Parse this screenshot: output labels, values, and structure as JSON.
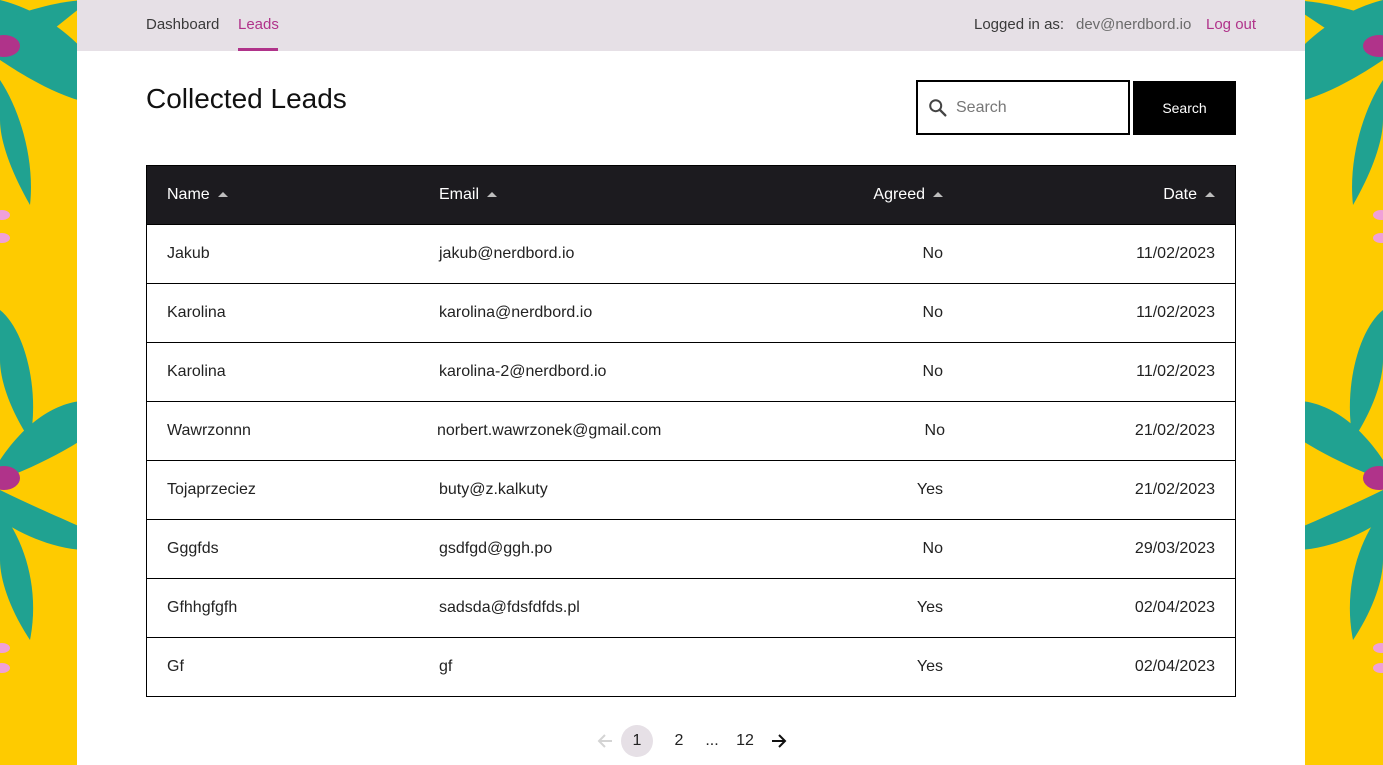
{
  "nav": {
    "items": [
      {
        "label": "Dashboard",
        "active": false
      },
      {
        "label": "Leads",
        "active": true
      }
    ],
    "logged_in_label": "Logged in as:",
    "user_email": "dev@nerdbord.io",
    "logout_label": "Log out"
  },
  "page": {
    "title": "Collected Leads"
  },
  "search": {
    "placeholder": "Search",
    "value": "",
    "button_label": "Search"
  },
  "table": {
    "columns": [
      {
        "label": "Name"
      },
      {
        "label": "Email"
      },
      {
        "label": "Agreed"
      },
      {
        "label": "Date"
      }
    ],
    "rows": [
      {
        "name": "Jakub",
        "email": "jakub@nerdbord.io",
        "agreed": "No",
        "date": "11/02/2023"
      },
      {
        "name": "Karolina",
        "email": "karolina@nerdbord.io",
        "agreed": "No",
        "date": "11/02/2023"
      },
      {
        "name": "Karolina",
        "email": "karolina-2@nerdbord.io",
        "agreed": "No",
        "date": "11/02/2023"
      },
      {
        "name": "Wawrzonnn",
        "email": "norbert.wawrzonek@gmail.com",
        "agreed": "No",
        "date": "21/02/2023"
      },
      {
        "name": "Tojaprzeciez",
        "email": "buty@z.kalkuty",
        "agreed": "Yes",
        "date": "21/02/2023"
      },
      {
        "name": "Gggfds",
        "email": "gsdfgd@ggh.po",
        "agreed": "No",
        "date": "29/03/2023"
      },
      {
        "name": "Gfhhgfgfh",
        "email": "sadsda@fdsfdfds.pl",
        "agreed": "Yes",
        "date": "02/04/2023"
      },
      {
        "name": "Gf",
        "email": "gf",
        "agreed": "Yes",
        "date": "02/04/2023"
      }
    ]
  },
  "pagination": {
    "pages": [
      "1",
      "2",
      "...",
      "12"
    ],
    "current": "1",
    "prev_icon": "arrow-left-icon",
    "next_icon": "arrow-right-icon"
  },
  "colors": {
    "background": "#fecb00",
    "accent": "#b0338a",
    "header_bg": "#1c1b1f",
    "topbar_bg": "#e6e0e6",
    "leaf": "#20a291",
    "flower_center": "#b0338a"
  }
}
